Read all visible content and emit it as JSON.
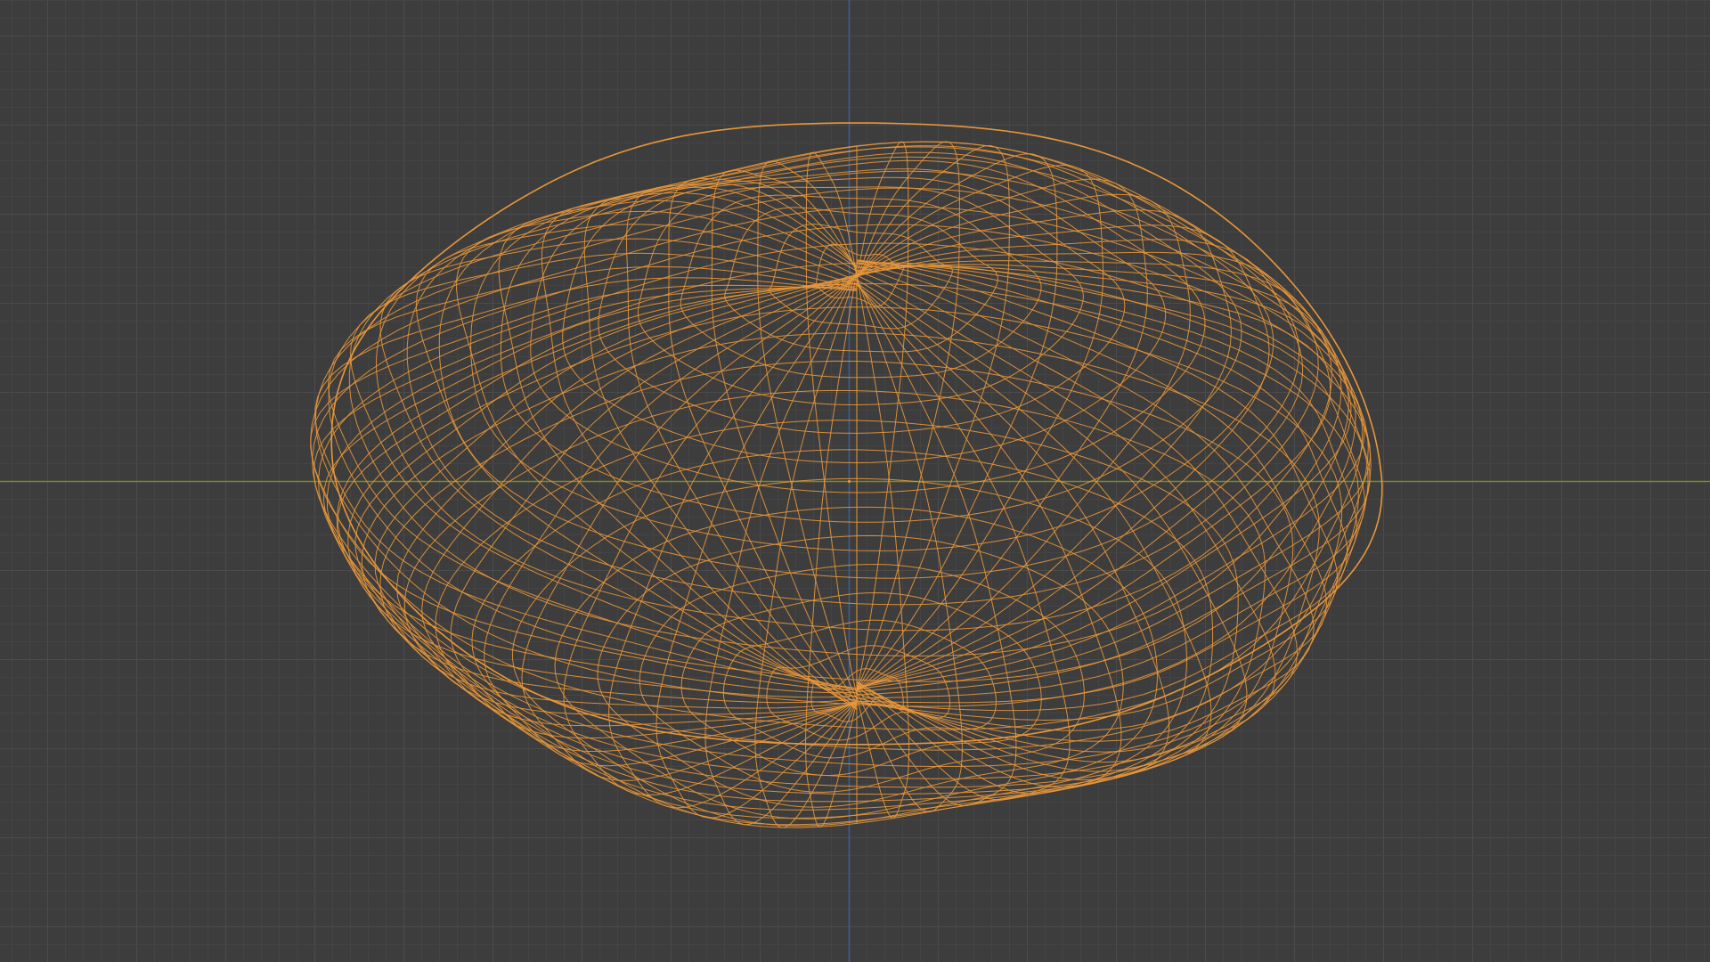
{
  "app": {
    "view": "3D Viewport",
    "shading": "wireframe"
  },
  "viewport": {
    "background_color": "#3d3d3d",
    "grid_minor_color": "#444444",
    "grid_major_color": "#4b4b4b",
    "x_axis_color": "#7a8a2c",
    "z_axis_color": "#3b5f9e",
    "grid_visible": true,
    "axes_visible": [
      "X",
      "Z"
    ]
  },
  "object": {
    "type": "mesh",
    "state": "selected",
    "shape": "ellipsoid-rock",
    "wire_color": "#e8973a",
    "origin_color": "#e8973a"
  }
}
